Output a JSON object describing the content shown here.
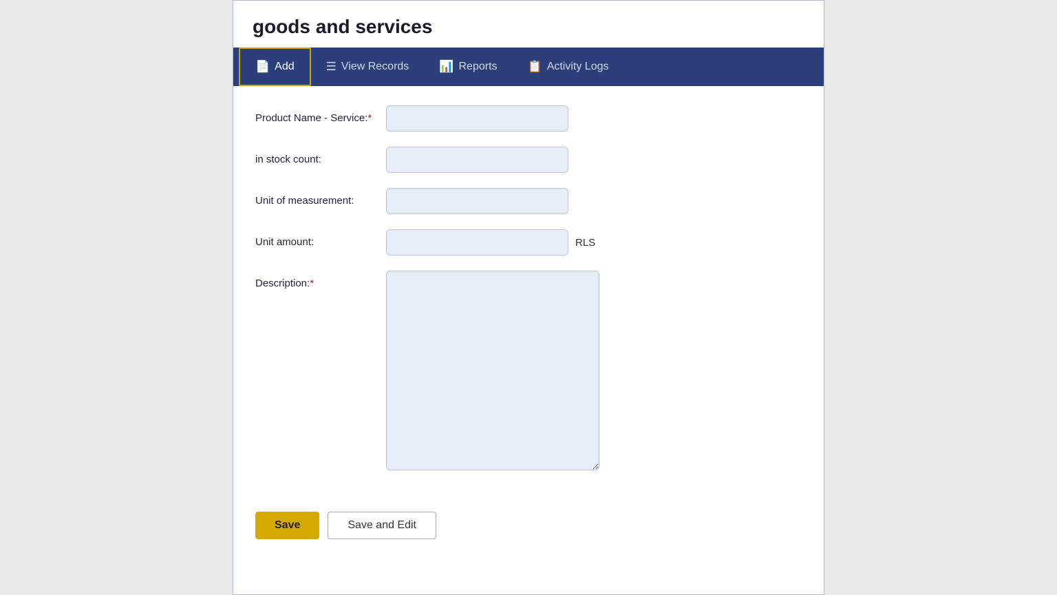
{
  "page": {
    "title": "goods and services"
  },
  "nav": {
    "tabs": [
      {
        "id": "add",
        "label": "Add",
        "icon": "add-icon",
        "active": true
      },
      {
        "id": "view-records",
        "label": "View Records",
        "icon": "view-records-icon",
        "active": false
      },
      {
        "id": "reports",
        "label": "Reports",
        "icon": "reports-icon",
        "active": false
      },
      {
        "id": "activity-logs",
        "label": "Activity Logs",
        "icon": "activity-logs-icon",
        "active": false
      }
    ]
  },
  "form": {
    "fields": {
      "product_name_label": "Product Name - Service:",
      "product_name_required": "*",
      "in_stock_label": "in stock count:",
      "unit_measurement_label": "Unit of measurement:",
      "unit_amount_label": "Unit amount:",
      "unit_currency": "RLS",
      "description_label": "Description:",
      "description_required": "*"
    }
  },
  "buttons": {
    "save_label": "Save",
    "save_edit_label": "Save and Edit"
  }
}
